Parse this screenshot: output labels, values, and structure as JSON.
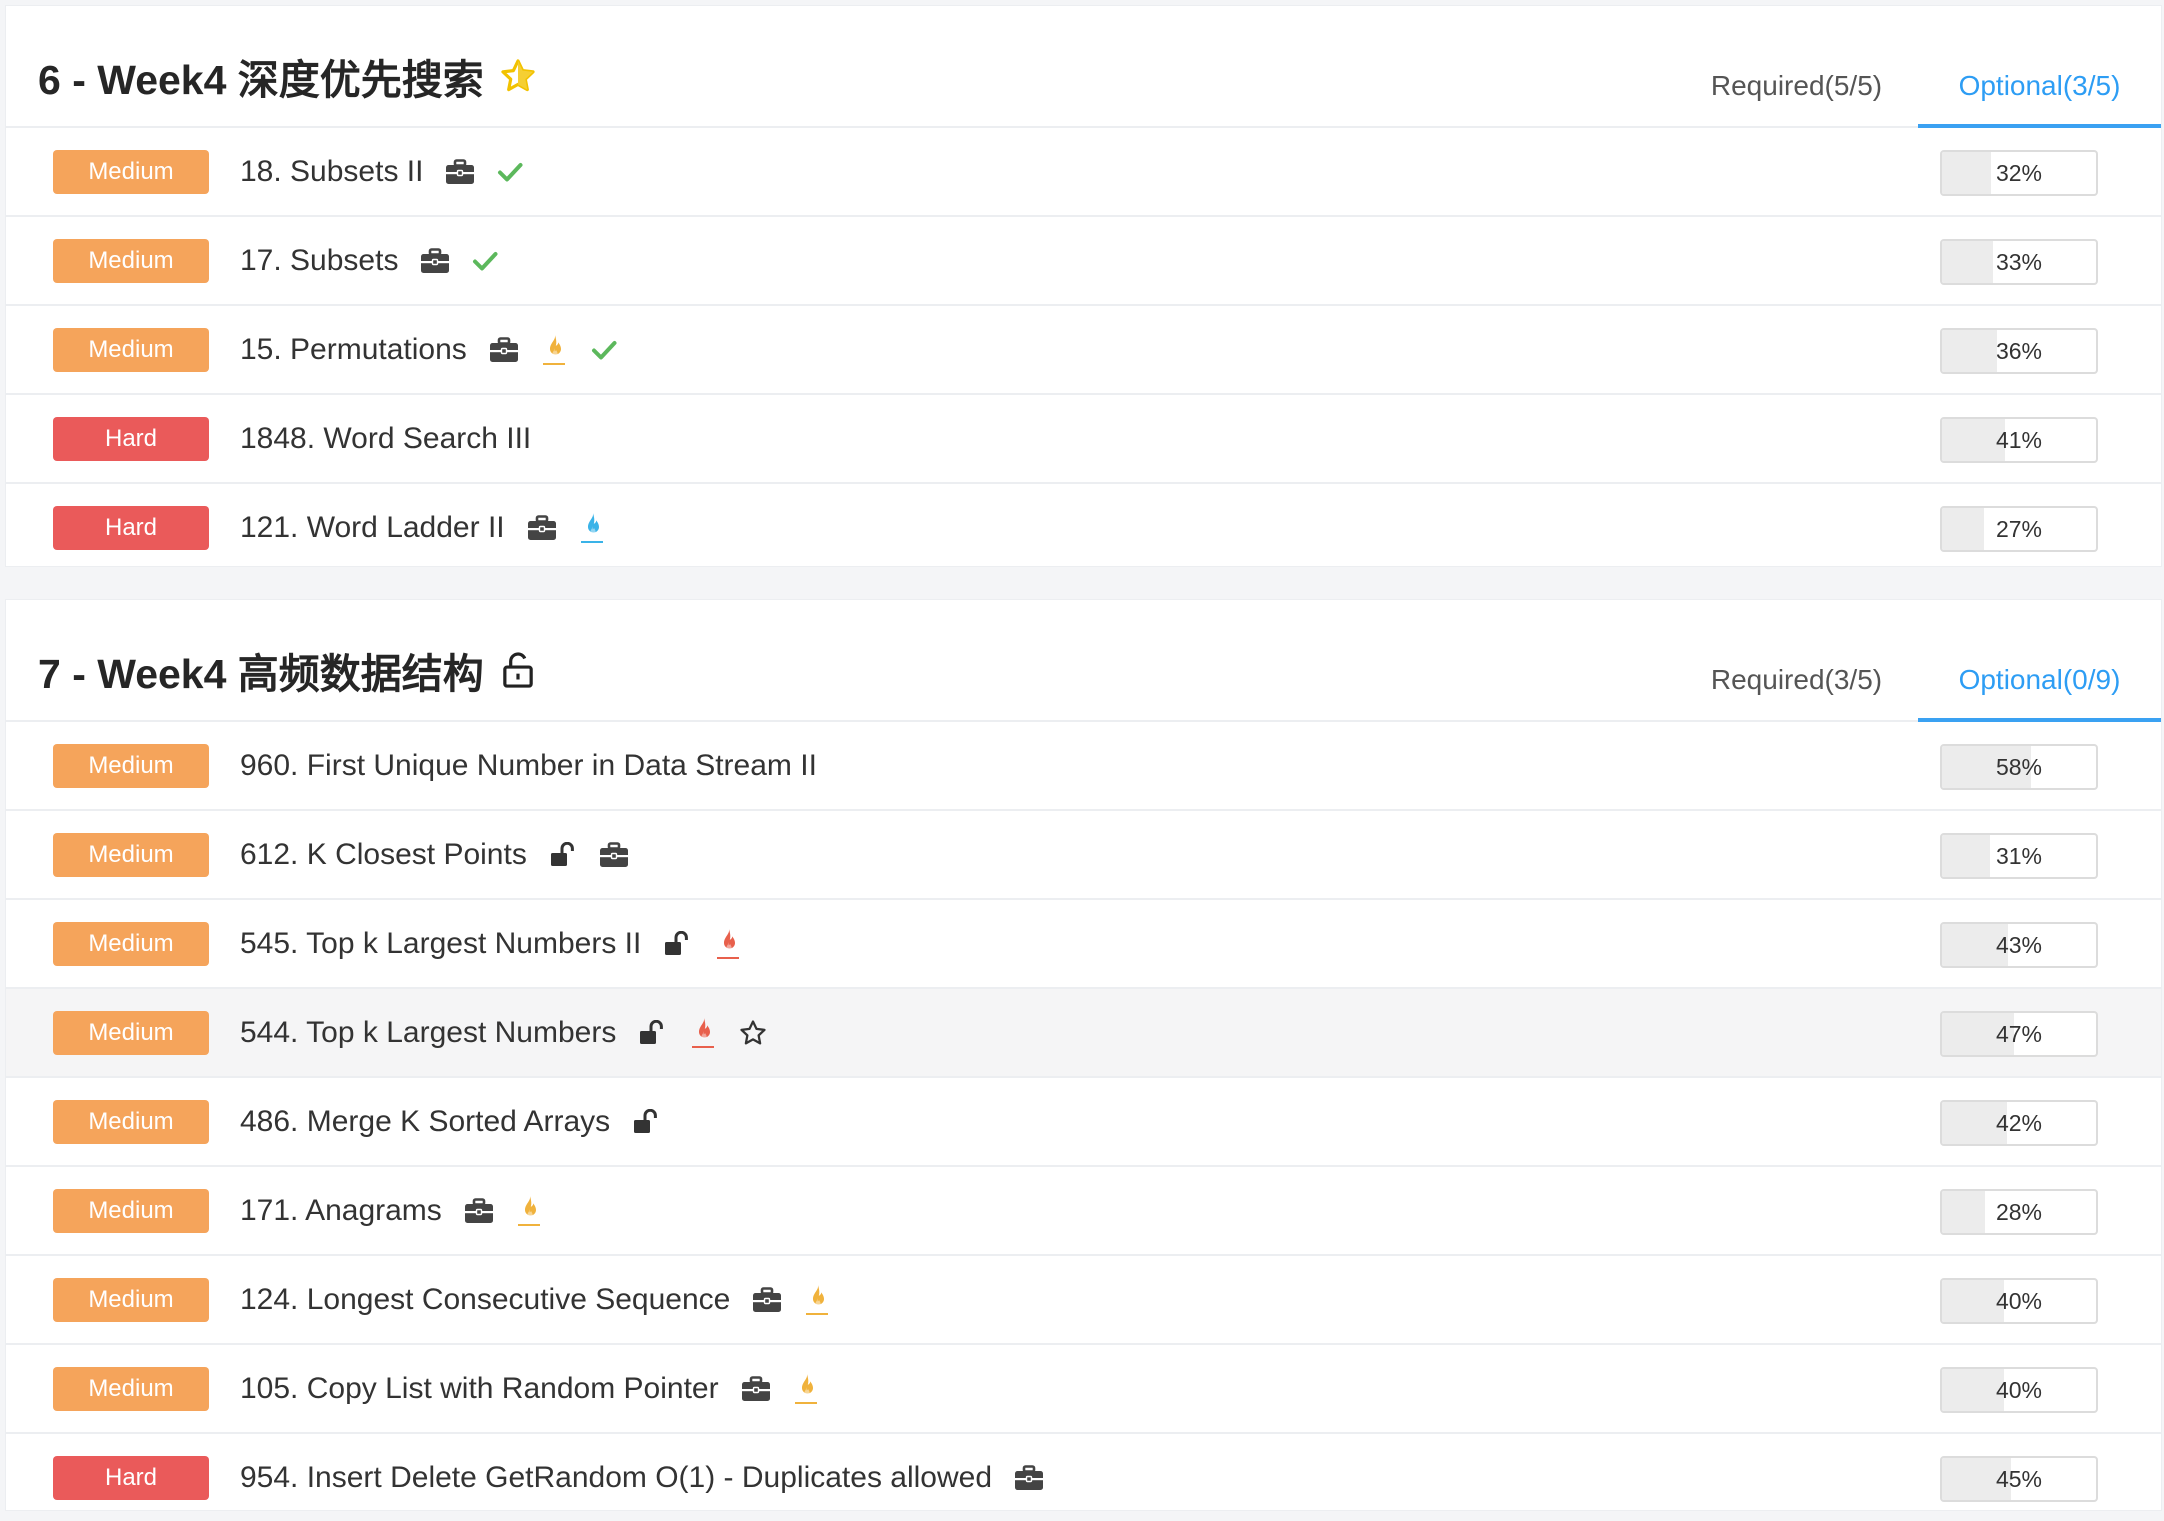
{
  "colors": {
    "medium": "#f5a45b",
    "hard": "#ea5a5a",
    "accent": "#2d9df4",
    "check": "#5cb85c",
    "flame_orange": "#f0b23c",
    "flame_red": "#e8604c",
    "flame_blue": "#3ab3e8"
  },
  "sections": [
    {
      "title": "6 - Week4 深度优先搜索",
      "title_icon": "star-outline-icon",
      "tabs": [
        {
          "label": "Required(5/5)",
          "active": false
        },
        {
          "label": "Optional(3/5)",
          "active": true
        }
      ],
      "problems": [
        {
          "difficulty": "Medium",
          "name": "18. Subsets II",
          "icons": [
            "briefcase-icon",
            "check-icon"
          ],
          "percent": 32,
          "percent_label": "32%"
        },
        {
          "difficulty": "Medium",
          "name": "17. Subsets",
          "icons": [
            "briefcase-icon",
            "check-icon"
          ],
          "percent": 33,
          "percent_label": "33%"
        },
        {
          "difficulty": "Medium",
          "name": "15. Permutations",
          "icons": [
            "briefcase-icon",
            "flame-orange-icon",
            "check-icon"
          ],
          "percent": 36,
          "percent_label": "36%"
        },
        {
          "difficulty": "Hard",
          "name": "1848. Word Search III",
          "icons": [],
          "percent": 41,
          "percent_label": "41%"
        },
        {
          "difficulty": "Hard",
          "name": "121. Word Ladder II",
          "icons": [
            "briefcase-icon",
            "flame-blue-icon"
          ],
          "percent": 27,
          "percent_label": "27%"
        }
      ]
    },
    {
      "title": "7 - Week4 高频数据结构",
      "title_icon": "unlock-icon",
      "tabs": [
        {
          "label": "Required(3/5)",
          "active": false
        },
        {
          "label": "Optional(0/9)",
          "active": true
        }
      ],
      "problems": [
        {
          "difficulty": "Medium",
          "name": "960. First Unique Number in Data Stream II",
          "icons": [],
          "percent": 58,
          "percent_label": "58%"
        },
        {
          "difficulty": "Medium",
          "name": "612. K Closest Points",
          "icons": [
            "unlock-small-icon",
            "briefcase-icon"
          ],
          "percent": 31,
          "percent_label": "31%"
        },
        {
          "difficulty": "Medium",
          "name": "545. Top k Largest Numbers II",
          "icons": [
            "unlock-small-icon",
            "flame-red-icon"
          ],
          "percent": 43,
          "percent_label": "43%"
        },
        {
          "difficulty": "Medium",
          "name": "544. Top k Largest Numbers",
          "icons": [
            "unlock-small-icon",
            "flame-red-icon",
            "star-outline-small-icon"
          ],
          "percent": 47,
          "percent_label": "47%",
          "hover": true
        },
        {
          "difficulty": "Medium",
          "name": "486. Merge K Sorted Arrays",
          "icons": [
            "unlock-small-icon"
          ],
          "percent": 42,
          "percent_label": "42%"
        },
        {
          "difficulty": "Medium",
          "name": "171. Anagrams",
          "icons": [
            "briefcase-icon",
            "flame-orange-icon"
          ],
          "percent": 28,
          "percent_label": "28%"
        },
        {
          "difficulty": "Medium",
          "name": "124. Longest Consecutive Sequence",
          "icons": [
            "briefcase-icon",
            "flame-orange-icon"
          ],
          "percent": 40,
          "percent_label": "40%"
        },
        {
          "difficulty": "Medium",
          "name": "105. Copy List with Random Pointer",
          "icons": [
            "briefcase-icon",
            "flame-orange-icon"
          ],
          "percent": 40,
          "percent_label": "40%"
        },
        {
          "difficulty": "Hard",
          "name": "954. Insert Delete GetRandom O(1) - Duplicates allowed",
          "icons": [
            "briefcase-icon"
          ],
          "percent": 45,
          "percent_label": "45%"
        }
      ]
    }
  ]
}
